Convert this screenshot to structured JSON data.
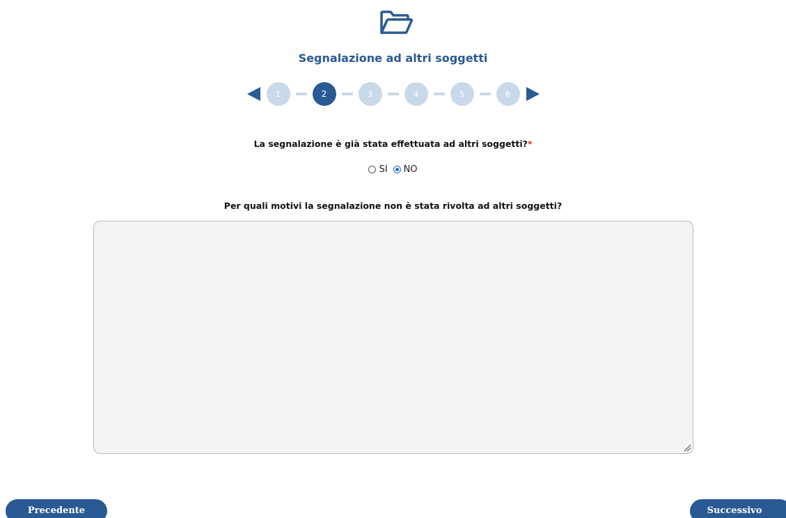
{
  "header": {
    "icon": "folder-open-icon",
    "title": "Segnalazione ad altri soggetti"
  },
  "stepper": {
    "prev_icon": "arrow-left-icon",
    "next_icon": "arrow-right-icon",
    "steps": [
      "1",
      "2",
      "3",
      "4",
      "5",
      "6"
    ],
    "current_step": 2
  },
  "form": {
    "question1": {
      "label": "La segnalazione è già stata effettuata ad altri soggetti?",
      "required_marker": "*",
      "options": [
        {
          "label": "SI",
          "checked": false
        },
        {
          "label": "NO",
          "checked": true
        }
      ]
    },
    "question2": {
      "label": "Per quali motivi la segnalazione non è stata rivolta ad altri soggetti?",
      "value": ""
    }
  },
  "footer": {
    "prev_label": "Precedente",
    "next_label": "Successivo"
  },
  "colors": {
    "accent": "#2a5a94",
    "step_inactive": "#c9d9ea",
    "required": "#d9302b",
    "textarea_bg": "#f4f4f4"
  }
}
